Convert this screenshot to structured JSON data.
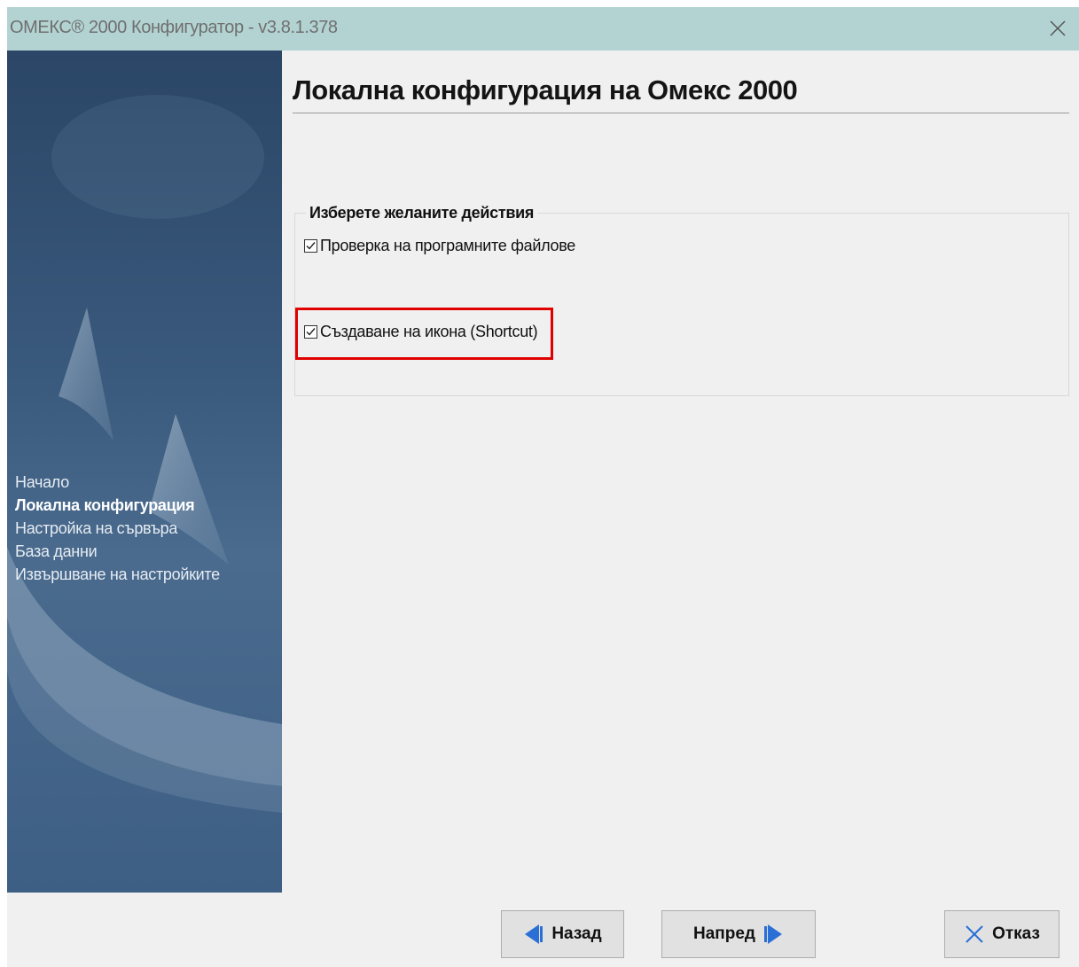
{
  "window": {
    "title": "ОМЕКС® 2000 Конфигуратор - v3.8.1.378"
  },
  "sidebar": {
    "steps": [
      {
        "label": "Начало",
        "active": false
      },
      {
        "label": "Локална конфигурация",
        "active": true
      },
      {
        "label": "Настройка на сървъра",
        "active": false
      },
      {
        "label": "База данни",
        "active": false
      },
      {
        "label": "Извършване на настройките",
        "active": false
      }
    ]
  },
  "main": {
    "title": "Локална конфигурация на Омекс 2000",
    "group": {
      "legend": "Изберете желаните действия",
      "options": [
        {
          "label": "Проверка на програмните файлове",
          "checked": true
        },
        {
          "label": "Създаване на икона (Shortcut)",
          "checked": true
        }
      ]
    }
  },
  "footer": {
    "back_label": "Назад",
    "next_label": "Напред",
    "cancel_label": "Отказ"
  },
  "colors": {
    "titlebar": "#b3d3d3",
    "highlight": "#e00000",
    "arrow": "#2a6fd6"
  }
}
